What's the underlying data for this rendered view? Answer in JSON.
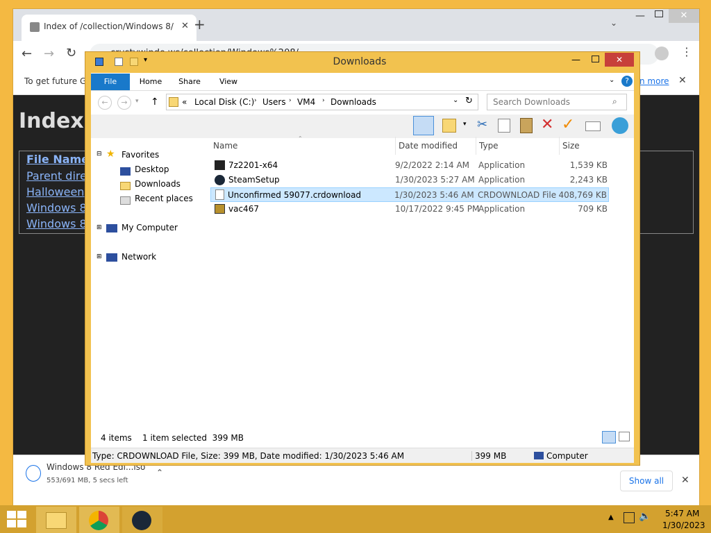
{
  "chrome": {
    "tab_title": "Index of /collection/Windows 8/",
    "url": "crustywindo.ws/collection/Windows%208/",
    "infobar_text": "To get future Go",
    "infobar_link": "n more",
    "page_title": "Index o",
    "page_header_col": "File Name",
    "page_links": [
      "Parent direc",
      "Halloweenpa",
      "Windows 8 C",
      "Windows 8 R"
    ],
    "download_name": "Windows 8 Red Edi...iso",
    "download_status": "553/691 MB, 5 secs left",
    "show_all": "Show all"
  },
  "explorer": {
    "title": "Downloads",
    "ribbon_tabs": [
      "File",
      "Home",
      "Share",
      "View"
    ],
    "breadcrumb": [
      "«",
      "Local Disk (C:)",
      "Users",
      "VM4",
      "Downloads"
    ],
    "search_placeholder": "Search Downloads",
    "nav": {
      "favorites": "Favorites",
      "desktop": "Desktop",
      "downloads": "Downloads",
      "recent": "Recent places",
      "computer": "My Computer",
      "network": "Network"
    },
    "columns": [
      "Name",
      "Date modified",
      "Type",
      "Size"
    ],
    "files": [
      {
        "name": "7z2201-x64",
        "date": "9/2/2022 2:14 AM",
        "type": "Application",
        "size": "1,539 KB"
      },
      {
        "name": "SteamSetup",
        "date": "1/30/2023 5:27 AM",
        "type": "Application",
        "size": "2,243 KB"
      },
      {
        "name": "Unconfirmed 59077.crdownload",
        "date": "1/30/2023 5:46 AM",
        "type": "CRDOWNLOAD File",
        "size": "408,769 KB"
      },
      {
        "name": "vac467",
        "date": "10/17/2022 9:45 PM",
        "type": "Application",
        "size": "709 KB"
      }
    ],
    "status_items": "4 items",
    "status_selected": "1 item selected  399 MB",
    "details_text": "Type: CRDOWNLOAD File, Size: 399 MB, Date modified: 1/30/2023 5:46 AM",
    "details_size": "399 MB",
    "details_location": "Computer"
  },
  "taskbar": {
    "time": "5:47 AM",
    "date": "1/30/2023"
  },
  "colors": {
    "accent": "#1979ca",
    "frame": "#f2c24f",
    "taskbar": "#d3a12f",
    "selection": "#cce8ff"
  }
}
